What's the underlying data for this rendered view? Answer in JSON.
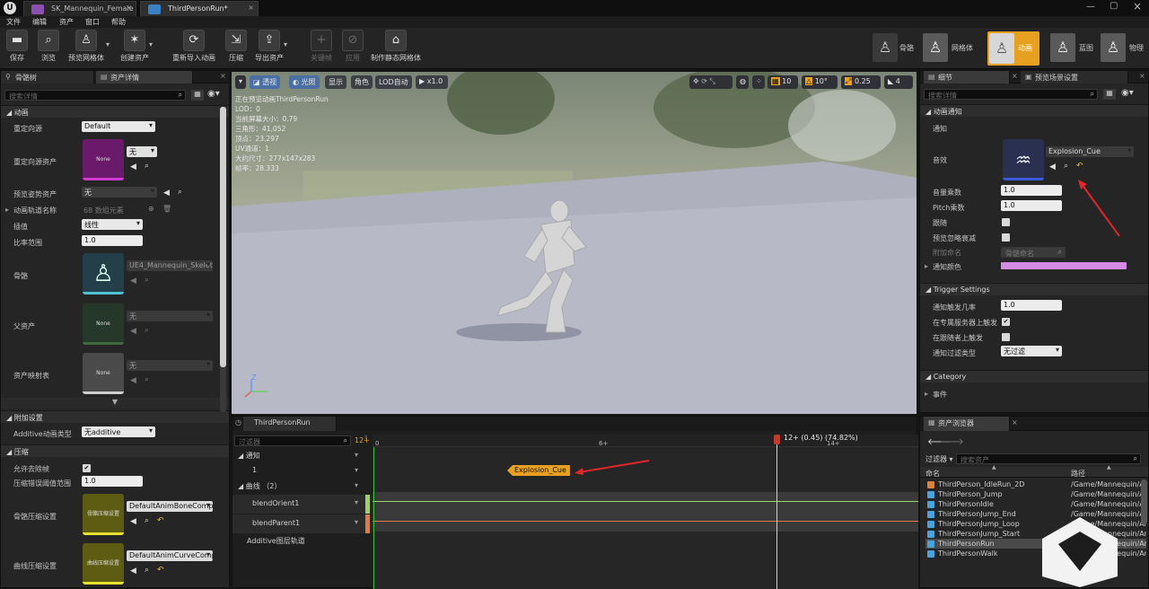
{
  "tabs": [
    {
      "label": "SK_Mannequin_Female"
    },
    {
      "label": "ThirdPersonRun*"
    }
  ],
  "menu": [
    "文件",
    "编辑",
    "资产",
    "窗口",
    "帮助"
  ],
  "toolbar": {
    "save": "保存",
    "browse": "浏览",
    "preview_mesh": "预览网格体",
    "create_asset": "创建资产",
    "reimport": "重新导入动画",
    "compress": "压缩",
    "export": "导出资产",
    "keyframe": "关键帧",
    "apply": "应用",
    "make_static": "制作静态网格体",
    "modes": [
      "骨骼",
      "网格体",
      "动画",
      "蓝图",
      "物理"
    ]
  },
  "left_panel": {
    "tabs": [
      "骨骼树",
      "资产详情"
    ],
    "search_placeholder": "搜索详情",
    "sections": {
      "animation": "动画",
      "additional": "附加设置",
      "compression": "压缩"
    },
    "rows": {
      "retarget_source": {
        "label": "重定向源",
        "value": "Default"
      },
      "retarget_source_asset": {
        "label": "重定向源资产",
        "thumb": "None",
        "value": "无"
      },
      "preview_pose_asset": {
        "label": "预览姿势资产",
        "value": "无"
      },
      "anim_track_names": {
        "label": "动画轨道名称",
        "value": "68 数组元素"
      },
      "interpolation": {
        "label": "插值",
        "value": "线性"
      },
      "rate_scale": {
        "label": "比率范围",
        "value": "1.0"
      },
      "skeleton": {
        "label": "骨骼",
        "value": "UE4_Mannequin_Skeleton"
      },
      "parent_asset": {
        "label": "父资产",
        "thumb": "None",
        "value": "无"
      },
      "asset_mapping": {
        "label": "资产映射表",
        "thumb": "None",
        "value": "无"
      },
      "additive_type": {
        "label": "Additive动画类型",
        "value": "无additive"
      },
      "allow_strip": {
        "label": "允许去除帧"
      },
      "compression_error": {
        "label": "压缩错误阈值范围",
        "value": "1.0"
      },
      "bone_compression": {
        "label": "骨骼压缩设置",
        "thumb": "骨骼压缩设置",
        "value": "DefaultAnimBoneCompres"
      },
      "curve_compression": {
        "label": "曲线压缩设置",
        "thumb": "曲线压缩设置",
        "value": "DefaultAnimCurveCompre"
      }
    }
  },
  "viewport": {
    "buttons": {
      "perspective": "透视",
      "lit": "光照",
      "show": "显示",
      "character": "角色",
      "lod": "LOD自动",
      "speed": "x1.0"
    },
    "right_buttons": {
      "grid": "10",
      "angle": "10°",
      "scale": "0.25",
      "cam": "4"
    },
    "stats": [
      "正在预览动画ThirdPersonRun",
      "LOD：0",
      "当前屏幕大小：0.79",
      "三角形：41,052",
      "顶点：23,297",
      "UV通道：1",
      "大约尺寸：277x147x283",
      "帧率：28.333"
    ]
  },
  "timeline": {
    "tab": "ThirdPersonRun",
    "filter_placeholder": "过滤器",
    "frame_label": "12+",
    "ticks": [
      "0",
      "6+",
      "14+"
    ],
    "playhead_label": "12+ (0.45) (74.82%)",
    "progress_fraction": 0.7482,
    "tracks": {
      "notify": "通知",
      "notify_row": "1",
      "curves": "曲线 （2）",
      "curve1": "blendOrient1",
      "curve2": "blendParent1",
      "additive": "Additive图层轨道"
    },
    "notify_label": "Explosion_Cue"
  },
  "details": {
    "tabs": [
      "细节",
      "预览场景设置"
    ],
    "search_placeholder": "搜索详情",
    "section_anim_notify": "动画通知",
    "notify_label": "通知",
    "sound_label": "音效",
    "sound_value": "Explosion_Cue",
    "volume": {
      "label": "音量乘数",
      "value": "1.0"
    },
    "pitch": {
      "label": "Pitch乘数",
      "value": "1.0"
    },
    "follow": {
      "label": "跟随"
    },
    "preview_ignore": {
      "label": "预览忽略衰减"
    },
    "attach_name": {
      "label": "附加命名",
      "placeholder": "骨骼命名"
    },
    "notify_color": {
      "label": "通知颜色",
      "color": "#d38be6"
    },
    "trigger_section": "Trigger Settings",
    "trigger_chance": {
      "label": "通知触发几率",
      "value": "1.0"
    },
    "dedicated_server": {
      "label": "在专属服务器上触发"
    },
    "follower": {
      "label": "在跟随者上触发"
    },
    "filter_type": {
      "label": "通知过滤类型",
      "value": "无过滤"
    },
    "category_section": "Category",
    "event": "事件"
  },
  "asset_browser": {
    "tab": "资产浏览器",
    "filter_label": "过滤器",
    "search_placeholder": "搜索资产",
    "col_name": "命名",
    "col_path": "路径",
    "items": [
      {
        "name": "ThirdPerson_IdleRun_2D",
        "path": "/Game/Mannequin/Ar",
        "color": "#d9843a"
      },
      {
        "name": "ThirdPerson_Jump",
        "path": "/Game/Mannequin/Ar",
        "color": "#4aa3df"
      },
      {
        "name": "ThirdPersonIdle",
        "path": "/Game/Mannequin/Ar",
        "color": "#4aa3df"
      },
      {
        "name": "ThirdPersonJump_End",
        "path": "/Game/Mannequin/Ar",
        "color": "#4aa3df"
      },
      {
        "name": "ThirdPersonJump_Loop",
        "path": "/Game/Mannequin/Ar",
        "color": "#4aa3df"
      },
      {
        "name": "ThirdPersonJump_Start",
        "path": "/Game/Mannequin/Ar",
        "color": "#4aa3df"
      },
      {
        "name": "ThirdPersonRun",
        "path": "/Game/Mannequin/Ar",
        "color": "#4aa3df"
      },
      {
        "name": "ThirdPersonWalk",
        "path": "/Game/Mannequin/Ar",
        "color": "#4aa3df"
      }
    ]
  },
  "colors": {
    "accent_orange": "#e8a020",
    "annotation_red": "#e0262b",
    "curve_green": "#9ed36a",
    "curve_orange": "#e07a4a"
  }
}
